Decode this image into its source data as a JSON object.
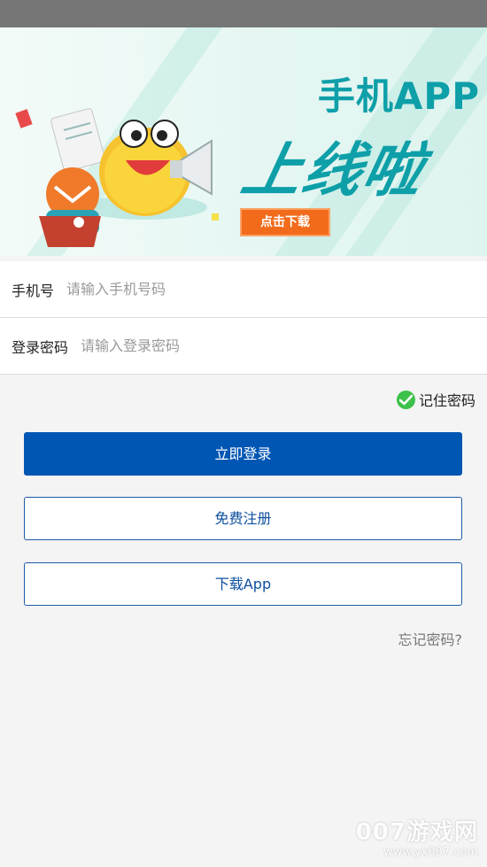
{
  "banner": {
    "title_line1": "手机APP",
    "title_line2": "上线啦",
    "download_button": "点击下载",
    "accent_color": "#0e9fa8",
    "button_color": "#f26b1b"
  },
  "form": {
    "phone": {
      "label": "手机号",
      "placeholder": "请输入手机号码",
      "value": ""
    },
    "password": {
      "label": "登录密码",
      "placeholder": "请输入登录密码",
      "value": ""
    }
  },
  "remember": {
    "label": "记住密码",
    "checked": true,
    "icon": "check-circle-icon",
    "color": "#3ec14a"
  },
  "buttons": {
    "login": "立即登录",
    "register": "免费注册",
    "download_app": "下载App",
    "primary_color": "#0056b3"
  },
  "forgot_password": "忘记密码?",
  "watermark": {
    "main": "007游戏网",
    "sub": "www.yx007.com"
  }
}
